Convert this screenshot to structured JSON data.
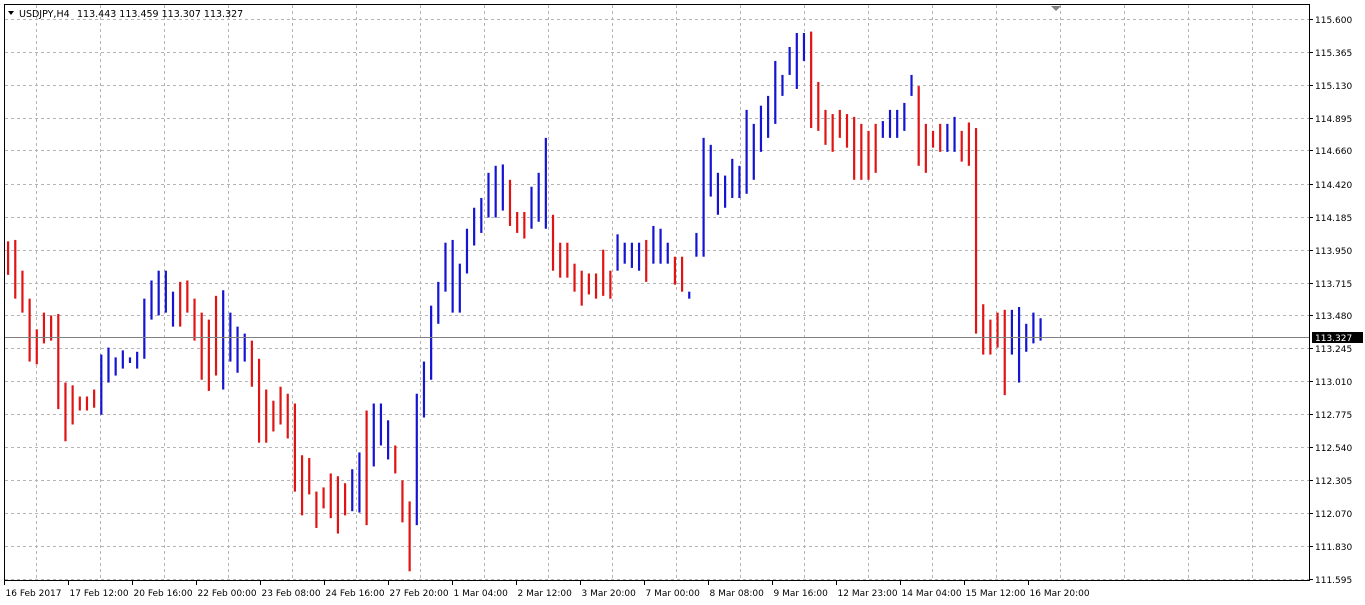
{
  "header": {
    "symbol": "USDJPY,H4",
    "ohlc": "113.443 113.459 113.307 113.327"
  },
  "colors": {
    "background": "#ffffff",
    "grid": "#b4b4b4",
    "frame": "#000000",
    "up_bar": "#1414d2",
    "down_bar": "#e01414",
    "price_line": "#808080",
    "price_tag_bg": "#000000",
    "price_tag_fg": "#ffffff"
  },
  "chart_data": {
    "type": "ohlc-bars",
    "symbol": "USDJPY",
    "timeframe": "H4",
    "y_ticks": [
      "115.600",
      "115.365",
      "115.130",
      "114.895",
      "114.660",
      "114.420",
      "114.185",
      "113.950",
      "113.715",
      "113.480",
      "113.245",
      "113.010",
      "112.775",
      "112.540",
      "112.305",
      "112.070",
      "111.830",
      "111.595"
    ],
    "ylim": [
      111.595,
      115.6
    ],
    "x_ticks": [
      "16 Feb 2017",
      "17 Feb 12:00",
      "20 Feb 16:00",
      "22 Feb 00:00",
      "23 Feb 08:00",
      "24 Feb 16:00",
      "27 Feb 20:00",
      "1 Mar 04:00",
      "2 Mar 12:00",
      "3 Mar 20:00",
      "7 Mar 00:00",
      "8 Mar 08:00",
      "9 Mar 16:00",
      "12 Mar 23:00",
      "14 Mar 04:00",
      "15 Mar 12:00",
      "16 Mar 20:00"
    ],
    "current_price": "113.327",
    "grid": true,
    "bars": [
      {
        "h": 114.01,
        "l": 113.77,
        "d": "down"
      },
      {
        "h": 114.02,
        "l": 113.6,
        "d": "down"
      },
      {
        "h": 113.8,
        "l": 113.5,
        "d": "down"
      },
      {
        "h": 113.6,
        "l": 113.15,
        "d": "down"
      },
      {
        "h": 113.38,
        "l": 113.13,
        "d": "down"
      },
      {
        "h": 113.5,
        "l": 113.28,
        "d": "down"
      },
      {
        "h": 113.48,
        "l": 113.3,
        "d": "down"
      },
      {
        "h": 113.49,
        "l": 112.81,
        "d": "down"
      },
      {
        "h": 113.0,
        "l": 112.58,
        "d": "down"
      },
      {
        "h": 112.98,
        "l": 112.7,
        "d": "down"
      },
      {
        "h": 112.9,
        "l": 112.8,
        "d": "down"
      },
      {
        "h": 112.9,
        "l": 112.8,
        "d": "down"
      },
      {
        "h": 112.95,
        "l": 112.82,
        "d": "down"
      },
      {
        "h": 113.2,
        "l": 112.77,
        "d": "up"
      },
      {
        "h": 113.25,
        "l": 113.0,
        "d": "up"
      },
      {
        "h": 113.18,
        "l": 113.05,
        "d": "up"
      },
      {
        "h": 113.23,
        "l": 113.1,
        "d": "up"
      },
      {
        "h": 113.18,
        "l": 113.14,
        "d": "up"
      },
      {
        "h": 113.22,
        "l": 113.1,
        "d": "up"
      },
      {
        "h": 113.6,
        "l": 113.17,
        "d": "up"
      },
      {
        "h": 113.73,
        "l": 113.45,
        "d": "up"
      },
      {
        "h": 113.8,
        "l": 113.48,
        "d": "up"
      },
      {
        "h": 113.8,
        "l": 113.5,
        "d": "up"
      },
      {
        "h": 113.65,
        "l": 113.4,
        "d": "up"
      },
      {
        "h": 113.72,
        "l": 113.4,
        "d": "down"
      },
      {
        "h": 113.73,
        "l": 113.5,
        "d": "down"
      },
      {
        "h": 113.6,
        "l": 113.3,
        "d": "down"
      },
      {
        "h": 113.5,
        "l": 113.02,
        "d": "down"
      },
      {
        "h": 113.45,
        "l": 112.94,
        "d": "down"
      },
      {
        "h": 113.62,
        "l": 113.05,
        "d": "down"
      },
      {
        "h": 113.66,
        "l": 112.95,
        "d": "up"
      },
      {
        "h": 113.5,
        "l": 113.15,
        "d": "up"
      },
      {
        "h": 113.4,
        "l": 113.07,
        "d": "up"
      },
      {
        "h": 113.35,
        "l": 113.15,
        "d": "up"
      },
      {
        "h": 113.3,
        "l": 112.97,
        "d": "down"
      },
      {
        "h": 113.17,
        "l": 112.57,
        "d": "down"
      },
      {
        "h": 112.95,
        "l": 112.57,
        "d": "down"
      },
      {
        "h": 112.87,
        "l": 112.65,
        "d": "down"
      },
      {
        "h": 112.97,
        "l": 112.7,
        "d": "down"
      },
      {
        "h": 112.92,
        "l": 112.6,
        "d": "down"
      },
      {
        "h": 112.85,
        "l": 112.22,
        "d": "down"
      },
      {
        "h": 112.48,
        "l": 112.05,
        "d": "down"
      },
      {
        "h": 112.46,
        "l": 112.2,
        "d": "down"
      },
      {
        "h": 112.22,
        "l": 111.96,
        "d": "down"
      },
      {
        "h": 112.25,
        "l": 112.1,
        "d": "down"
      },
      {
        "h": 112.35,
        "l": 112.03,
        "d": "down"
      },
      {
        "h": 112.33,
        "l": 111.92,
        "d": "down"
      },
      {
        "h": 112.28,
        "l": 112.05,
        "d": "down"
      },
      {
        "h": 112.38,
        "l": 112.08,
        "d": "up"
      },
      {
        "h": 112.5,
        "l": 112.07,
        "d": "up"
      },
      {
        "h": 112.8,
        "l": 111.98,
        "d": "down"
      },
      {
        "h": 112.85,
        "l": 112.4,
        "d": "up"
      },
      {
        "h": 112.85,
        "l": 112.55,
        "d": "up"
      },
      {
        "h": 112.73,
        "l": 112.45,
        "d": "up"
      },
      {
        "h": 112.55,
        "l": 112.35,
        "d": "down"
      },
      {
        "h": 112.3,
        "l": 112.0,
        "d": "down"
      },
      {
        "h": 112.15,
        "l": 111.65,
        "d": "down"
      },
      {
        "h": 112.92,
        "l": 111.98,
        "d": "up"
      },
      {
        "h": 113.15,
        "l": 112.75,
        "d": "up"
      },
      {
        "h": 113.55,
        "l": 113.02,
        "d": "up"
      },
      {
        "h": 113.72,
        "l": 113.42,
        "d": "up"
      },
      {
        "h": 114.0,
        "l": 113.65,
        "d": "up"
      },
      {
        "h": 114.02,
        "l": 113.5,
        "d": "up"
      },
      {
        "h": 113.85,
        "l": 113.5,
        "d": "up"
      },
      {
        "h": 114.1,
        "l": 113.78,
        "d": "up"
      },
      {
        "h": 114.25,
        "l": 113.98,
        "d": "up"
      },
      {
        "h": 114.32,
        "l": 114.07,
        "d": "up"
      },
      {
        "h": 114.5,
        "l": 114.18,
        "d": "up"
      },
      {
        "h": 114.55,
        "l": 114.18,
        "d": "up"
      },
      {
        "h": 114.56,
        "l": 114.23,
        "d": "up"
      },
      {
        "h": 114.45,
        "l": 114.12,
        "d": "down"
      },
      {
        "h": 114.22,
        "l": 114.07,
        "d": "down"
      },
      {
        "h": 114.22,
        "l": 114.03,
        "d": "down"
      },
      {
        "h": 114.4,
        "l": 114.1,
        "d": "up"
      },
      {
        "h": 114.5,
        "l": 114.15,
        "d": "up"
      },
      {
        "h": 114.75,
        "l": 114.1,
        "d": "up"
      },
      {
        "h": 114.2,
        "l": 113.8,
        "d": "down"
      },
      {
        "h": 114.0,
        "l": 113.75,
        "d": "down"
      },
      {
        "h": 114.0,
        "l": 113.75,
        "d": "down"
      },
      {
        "h": 113.85,
        "l": 113.65,
        "d": "down"
      },
      {
        "h": 113.8,
        "l": 113.55,
        "d": "down"
      },
      {
        "h": 113.78,
        "l": 113.63,
        "d": "down"
      },
      {
        "h": 113.78,
        "l": 113.6,
        "d": "down"
      },
      {
        "h": 113.95,
        "l": 113.62,
        "d": "down"
      },
      {
        "h": 113.8,
        "l": 113.6,
        "d": "down"
      },
      {
        "h": 114.06,
        "l": 113.8,
        "d": "up"
      },
      {
        "h": 114.0,
        "l": 113.85,
        "d": "up"
      },
      {
        "h": 114.0,
        "l": 113.82,
        "d": "up"
      },
      {
        "h": 114.0,
        "l": 113.8,
        "d": "up"
      },
      {
        "h": 114.02,
        "l": 113.72,
        "d": "down"
      },
      {
        "h": 114.12,
        "l": 113.85,
        "d": "up"
      },
      {
        "h": 114.1,
        "l": 113.85,
        "d": "up"
      },
      {
        "h": 114.0,
        "l": 113.85,
        "d": "up"
      },
      {
        "h": 113.9,
        "l": 113.7,
        "d": "down"
      },
      {
        "h": 113.9,
        "l": 113.65,
        "d": "down"
      },
      {
        "h": 113.65,
        "l": 113.6,
        "d": "up"
      },
      {
        "h": 114.07,
        "l": 113.9,
        "d": "up"
      },
      {
        "h": 114.75,
        "l": 113.9,
        "d": "up"
      },
      {
        "h": 114.7,
        "l": 114.33,
        "d": "up"
      },
      {
        "h": 114.5,
        "l": 114.2,
        "d": "up"
      },
      {
        "h": 114.48,
        "l": 114.25,
        "d": "up"
      },
      {
        "h": 114.6,
        "l": 114.32,
        "d": "up"
      },
      {
        "h": 114.55,
        "l": 114.32,
        "d": "up"
      },
      {
        "h": 114.95,
        "l": 114.35,
        "d": "up"
      },
      {
        "h": 114.85,
        "l": 114.45,
        "d": "up"
      },
      {
        "h": 114.98,
        "l": 114.65,
        "d": "up"
      },
      {
        "h": 115.05,
        "l": 114.75,
        "d": "up"
      },
      {
        "h": 115.3,
        "l": 114.85,
        "d": "up"
      },
      {
        "h": 115.2,
        "l": 115.05,
        "d": "up"
      },
      {
        "h": 115.4,
        "l": 115.2,
        "d": "up"
      },
      {
        "h": 115.5,
        "l": 115.1,
        "d": "up"
      },
      {
        "h": 115.5,
        "l": 115.3,
        "d": "up"
      },
      {
        "h": 115.51,
        "l": 114.82,
        "d": "down"
      },
      {
        "h": 115.15,
        "l": 114.8,
        "d": "down"
      },
      {
        "h": 114.95,
        "l": 114.7,
        "d": "down"
      },
      {
        "h": 114.92,
        "l": 114.65,
        "d": "down"
      },
      {
        "h": 114.95,
        "l": 114.75,
        "d": "down"
      },
      {
        "h": 114.92,
        "l": 114.68,
        "d": "down"
      },
      {
        "h": 114.9,
        "l": 114.45,
        "d": "down"
      },
      {
        "h": 114.85,
        "l": 114.45,
        "d": "down"
      },
      {
        "h": 114.8,
        "l": 114.45,
        "d": "down"
      },
      {
        "h": 114.85,
        "l": 114.5,
        "d": "down"
      },
      {
        "h": 114.87,
        "l": 114.75,
        "d": "up"
      },
      {
        "h": 114.95,
        "l": 114.75,
        "d": "up"
      },
      {
        "h": 114.95,
        "l": 114.75,
        "d": "up"
      },
      {
        "h": 115.0,
        "l": 114.8,
        "d": "up"
      },
      {
        "h": 115.2,
        "l": 115.05,
        "d": "up"
      },
      {
        "h": 115.12,
        "l": 114.55,
        "d": "down"
      },
      {
        "h": 114.85,
        "l": 114.5,
        "d": "down"
      },
      {
        "h": 114.8,
        "l": 114.68,
        "d": "down"
      },
      {
        "h": 114.85,
        "l": 114.65,
        "d": "down"
      },
      {
        "h": 114.85,
        "l": 114.65,
        "d": "up"
      },
      {
        "h": 114.9,
        "l": 114.65,
        "d": "up"
      },
      {
        "h": 114.8,
        "l": 114.58,
        "d": "down"
      },
      {
        "h": 114.86,
        "l": 114.55,
        "d": "down"
      },
      {
        "h": 114.82,
        "l": 113.35,
        "d": "down"
      },
      {
        "h": 113.56,
        "l": 113.2,
        "d": "down"
      },
      {
        "h": 113.45,
        "l": 113.2,
        "d": "down"
      },
      {
        "h": 113.5,
        "l": 113.25,
        "d": "down"
      },
      {
        "h": 113.52,
        "l": 112.91,
        "d": "down"
      },
      {
        "h": 113.52,
        "l": 113.2,
        "d": "up"
      },
      {
        "h": 113.54,
        "l": 113.0,
        "d": "up"
      },
      {
        "h": 113.42,
        "l": 113.22,
        "d": "up"
      },
      {
        "h": 113.5,
        "l": 113.28,
        "d": "up"
      },
      {
        "h": 113.46,
        "l": 113.3,
        "d": "up"
      }
    ]
  }
}
